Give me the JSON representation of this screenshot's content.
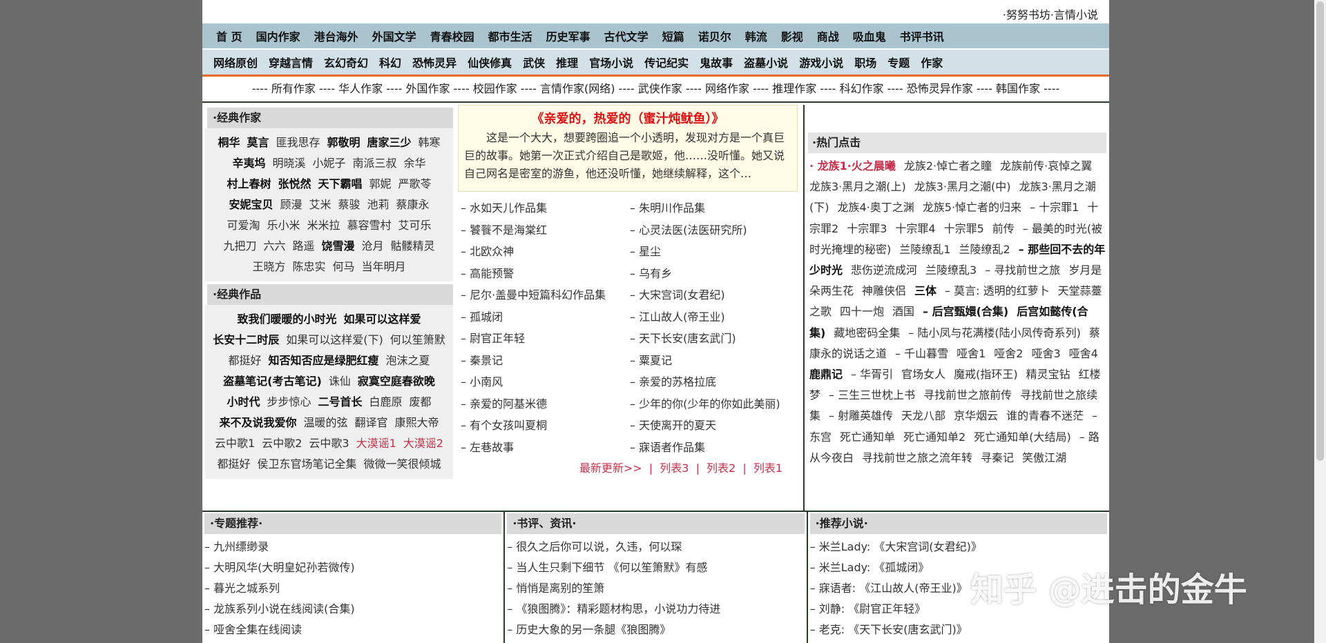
{
  "site_title": "·努努书坊·言情小说",
  "nav1": [
    "首 页",
    "国内作家",
    "港台海外",
    "外国文学",
    "青春校园",
    "都市生活",
    "历史军事",
    "古代文学",
    "短篇",
    "诺贝尔",
    "韩流",
    "影视",
    "商战",
    "吸血鬼",
    "书评书讯"
  ],
  "nav2": [
    "网络原创",
    "穿越言情",
    "玄幻奇幻",
    "科幻",
    "恐怖灵异",
    "仙侠修真",
    "武侠",
    "推理",
    "官场小说",
    "传记纪实",
    "鬼故事",
    "盗墓小说",
    "游戏小说",
    "职场",
    "专题",
    "作家"
  ],
  "authors_bar": "---- 所有作家 ---- 华人作家 ---- 外国作家 ---- 校园作家 ---- 言情作家(网络) ---- 武侠作家 ---- 网络作家 ---- 推理作家 ---- 科幻作家 ---- 恐怖灵异作家 ---- 韩国作家 ----",
  "classic_authors": {
    "heading": "·经典作家",
    "items": [
      {
        "t": "桐华",
        "b": true
      },
      {
        "t": "莫言",
        "b": true
      },
      {
        "t": "匪我思存"
      },
      {
        "t": "郭敬明",
        "b": true
      },
      {
        "t": "唐家三少",
        "b": true
      },
      {
        "t": "韩寒"
      },
      {
        "t": "辛夷坞",
        "b": true
      },
      {
        "t": "明晓溪"
      },
      {
        "t": "小妮子"
      },
      {
        "t": "南派三叔"
      },
      {
        "t": "余华"
      },
      {
        "t": "村上春树",
        "b": true
      },
      {
        "t": "张悦然",
        "b": true
      },
      {
        "t": "天下霸唱",
        "b": true
      },
      {
        "t": "郭妮"
      },
      {
        "t": "严歌苓"
      },
      {
        "t": "安妮宝贝",
        "b": true
      },
      {
        "t": "顾漫"
      },
      {
        "t": "艾米"
      },
      {
        "t": "蔡骏"
      },
      {
        "t": "池莉"
      },
      {
        "t": "蔡康永"
      },
      {
        "t": "可爱淘"
      },
      {
        "t": "乐小米"
      },
      {
        "t": "米米拉"
      },
      {
        "t": "慕容雪村"
      },
      {
        "t": "艾可乐"
      },
      {
        "t": "九把刀"
      },
      {
        "t": "六六"
      },
      {
        "t": "路遥"
      },
      {
        "t": "饶雪漫",
        "b": true
      },
      {
        "t": "沧月"
      },
      {
        "t": "骷髅精灵"
      },
      {
        "t": "王晓方"
      },
      {
        "t": "陈忠实"
      },
      {
        "t": "何马"
      },
      {
        "t": "当年明月"
      }
    ]
  },
  "classic_works": {
    "heading": "·经典作品",
    "items": [
      {
        "t": "致我们暖暖的小时光",
        "b": true
      },
      {
        "t": "如果可以这样爱",
        "b": true
      },
      {
        "t": "长安十二时辰",
        "b": true
      },
      {
        "t": "如果可以这样爱(下)"
      },
      {
        "t": "何以笙箫默"
      },
      {
        "t": "都挺好"
      },
      {
        "t": "知否知否应是绿肥红瘦",
        "b": true
      },
      {
        "t": "泡沫之夏"
      },
      {
        "t": "盗墓笔记(考古笔记)",
        "b": true
      },
      {
        "t": "诛仙"
      },
      {
        "t": "寂寞空庭春欲晚",
        "b": true
      },
      {
        "t": "小时代",
        "b": true
      },
      {
        "t": "步步惊心"
      },
      {
        "t": "二号首长",
        "b": true
      },
      {
        "t": "白鹿原"
      },
      {
        "t": "废都"
      },
      {
        "t": "来不及说我爱你",
        "b": true
      },
      {
        "t": "温暖的弦"
      },
      {
        "t": "翻译官"
      },
      {
        "t": "康熙大帝"
      },
      {
        "t": "云中歌1"
      },
      {
        "t": "云中歌2"
      },
      {
        "t": "云中歌3"
      },
      {
        "t": "大漠谣1",
        "r": true
      },
      {
        "t": "大漠谣2",
        "r": true
      },
      {
        "t": "都挺好"
      },
      {
        "t": "侯卫东官场笔记全集"
      },
      {
        "t": "微微一笑很倾城"
      }
    ]
  },
  "feature": {
    "title": "《亲爱的，热爱的（蜜汁炖鱿鱼）》",
    "text": "这是一个大大，想要跨圈追一个小透明，发现对方是一个真巨巨的故事。她第一次正式介绍自己是歌姬，他……没听懂。她又说自己网名是密室的游鱼，他还没听懂，她继续解释，这个…"
  },
  "booklist_left": [
    "– 水如天儿作品集",
    "– 饕餮不是海棠红",
    "– 北欧众神",
    "– 高能预警",
    "– 尼尔·盖曼中短篇科幻作品集",
    "– 孤城闭",
    "– 尉官正年轻",
    "– 秦景记",
    "– 小南风",
    "– 亲爱的阿基米德",
    "– 有个女孩叫夏桐",
    "– 左巷故事"
  ],
  "booklist_right": [
    "– 朱明川作品集",
    "– 心灵法医(法医研究所)",
    "– 星尘",
    "– 乌有乡",
    "– 大宋宫词(女君纪)",
    "– 江山故人(帝王业)",
    "– 天下长安(唐玄武门)",
    "– 粟夏记",
    "– 亲爱的苏格拉底",
    "– 少年的你(少年的你如此美丽)",
    "– 天使离开的夏天",
    "– 寐语者作品集"
  ],
  "more_links": {
    "latest": "最新更新>>",
    "list3": "列表3",
    "list2": "列表2",
    "list1": "列表1",
    "sep": "|"
  },
  "hot": {
    "heading": "·热门点击",
    "items": [
      {
        "t": "· 龙族1·火之晨曦",
        "r": true
      },
      {
        "t": "龙族2·悼亡者之瞳"
      },
      {
        "t": "龙族前传·哀悼之翼"
      },
      {
        "t": "龙族3·黑月之潮(上)"
      },
      {
        "t": "龙族3·黑月之潮(中)"
      },
      {
        "t": "龙族3·黑月之潮(下)"
      },
      {
        "t": "龙族4·奥丁之渊"
      },
      {
        "t": "龙族5·悼亡者的归来"
      },
      {
        "t": "– 十宗罪1"
      },
      {
        "t": "十宗罪2"
      },
      {
        "t": "十宗罪3"
      },
      {
        "t": "十宗罪4"
      },
      {
        "t": "十宗罪5"
      },
      {
        "t": "前传"
      },
      {
        "t": "– 最美的时光(被时光掩埋的秘密)"
      },
      {
        "t": "兰陵缭乱1"
      },
      {
        "t": "兰陵缭乱2"
      },
      {
        "t": "– 那些回不去的年少时光",
        "b": true
      },
      {
        "t": "悲伤逆流成河"
      },
      {
        "t": "兰陵缭乱3"
      },
      {
        "t": "– 寻找前世之旅"
      },
      {
        "t": "岁月是朵两生花"
      },
      {
        "t": "神雕侠侣"
      },
      {
        "t": "三体",
        "b": true
      },
      {
        "t": "– 莫言: 透明的红萝卜"
      },
      {
        "t": "天堂蒜薹之歌"
      },
      {
        "t": "四十一炮"
      },
      {
        "t": "酒国"
      },
      {
        "t": "– 后宫甄嬛(合集)",
        "b": true
      },
      {
        "t": "后宫如懿传(合集)",
        "b": true
      },
      {
        "t": "藏地密码全集"
      },
      {
        "t": "– 陆小凤与花满楼(陆小凤传奇系列)"
      },
      {
        "t": "蔡康永的说话之道"
      },
      {
        "t": "– 千山暮雪"
      },
      {
        "t": "哑舍1"
      },
      {
        "t": "哑舍2"
      },
      {
        "t": "哑舍3"
      },
      {
        "t": "哑舍4"
      },
      {
        "t": "鹿鼎记",
        "b": true
      },
      {
        "t": "– 华胥引"
      },
      {
        "t": "官场女人"
      },
      {
        "t": "魔戒(指环王)"
      },
      {
        "t": "精灵宝钻"
      },
      {
        "t": "红楼梦"
      },
      {
        "t": "– 三生三世枕上书"
      },
      {
        "t": "寻找前世之旅前传"
      },
      {
        "t": "寻找前世之旅续集"
      },
      {
        "t": "– 射雕英雄传"
      },
      {
        "t": "天龙八部"
      },
      {
        "t": "京华烟云"
      },
      {
        "t": "谁的青春不迷茫"
      },
      {
        "t": "– 东宫"
      },
      {
        "t": "死亡通知单"
      },
      {
        "t": "死亡通知单2"
      },
      {
        "t": "死亡通知单(大结局)"
      },
      {
        "t": "– 路从今夜白"
      },
      {
        "t": "寻找前世之旅之流年转"
      },
      {
        "t": "寻秦记"
      },
      {
        "t": "笑傲江湖"
      }
    ]
  },
  "bottom": [
    {
      "heading": "·专题推荐·",
      "items": [
        "– 九州缥缈录",
        "– 大明风华(大明皇妃孙若微传)",
        "– 暮光之城系列",
        "– 龙族系列小说在线阅读(合集)",
        "– 哑舍全集在线阅读"
      ]
    },
    {
      "heading": "·书评、资讯·",
      "items": [
        "– 很久之后你可以说，久违，何以琛",
        "– 当人生只剩下细节 《何以笙箫默》有感",
        "– 悄悄是离别的笙箫",
        "– 《狼图腾》：精彩题材构思，小说功力待进",
        "– 历史大象的另一条腿《狼图腾》"
      ]
    },
    {
      "heading": "·推荐小说·",
      "items": [
        "– 米兰Lady: 《大宋宫词(女君纪)》",
        "– 米兰Lady: 《孤城闭》",
        "– 寐语者: 《江山故人(帝王业)》",
        "– 刘静: 《尉官正年轻》",
        "– 老克: 《天下长安(唐玄武门)》"
      ]
    }
  ],
  "watermark": "知乎 @进击的金牛"
}
